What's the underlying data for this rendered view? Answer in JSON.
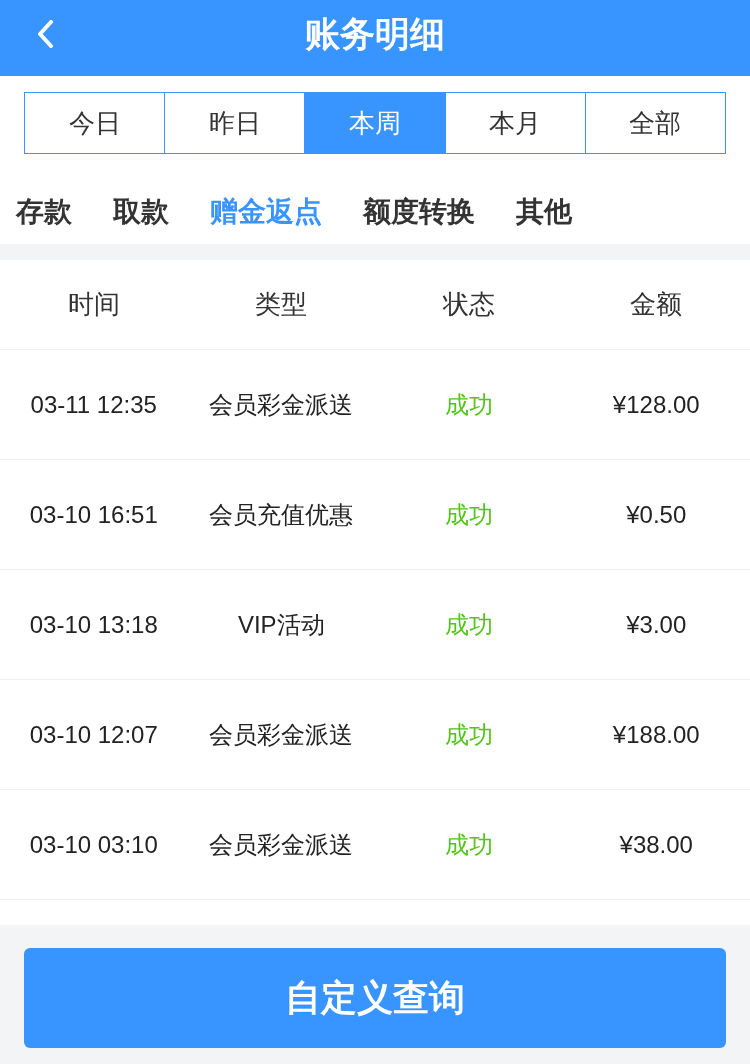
{
  "header": {
    "title": "账务明细"
  },
  "period_tabs": [
    {
      "label": "今日",
      "selected": false
    },
    {
      "label": "昨日",
      "selected": false
    },
    {
      "label": "本周",
      "selected": true
    },
    {
      "label": "本月",
      "selected": false
    },
    {
      "label": "全部",
      "selected": false
    }
  ],
  "category_tabs": [
    {
      "label": "存款",
      "selected": false
    },
    {
      "label": "取款",
      "selected": false
    },
    {
      "label": "赠金返点",
      "selected": true
    },
    {
      "label": "额度转换",
      "selected": false
    },
    {
      "label": "其他",
      "selected": false
    }
  ],
  "table": {
    "columns": [
      "时间",
      "类型",
      "状态",
      "金额"
    ],
    "rows": [
      {
        "time": "03-11 12:35",
        "type": "会员彩金派送",
        "status": "成功",
        "succeeded": true,
        "amount": "¥128.00"
      },
      {
        "time": "03-10 16:51",
        "type": "会员充值优惠",
        "status": "成功",
        "succeeded": true,
        "amount": "¥0.50"
      },
      {
        "time": "03-10 13:18",
        "type": "VIP活动",
        "status": "成功",
        "succeeded": true,
        "amount": "¥3.00"
      },
      {
        "time": "03-10 12:07",
        "type": "会员彩金派送",
        "status": "成功",
        "succeeded": true,
        "amount": "¥188.00"
      },
      {
        "time": "03-10 03:10",
        "type": "会员彩金派送",
        "status": "成功",
        "succeeded": true,
        "amount": "¥38.00"
      }
    ]
  },
  "query_button": {
    "label": "自定义查询"
  }
}
